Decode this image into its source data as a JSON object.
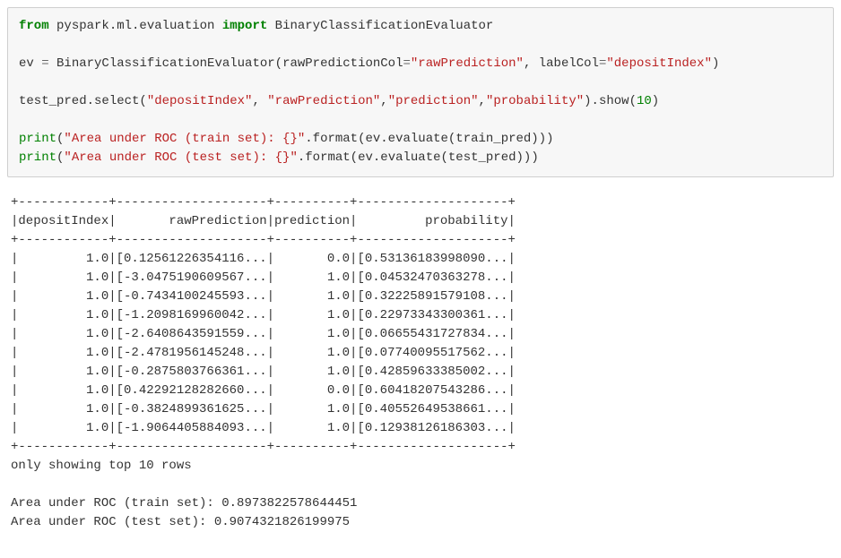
{
  "code": {
    "kw_from": "from",
    "mod1": " pyspark.ml.evaluation ",
    "kw_import": "import",
    "cls1": " BinaryClassificationEvaluator",
    "line2_a": "ev ",
    "op_eq": "=",
    "line2_b": " BinaryClassificationEvaluator(rawPredictionCol",
    "line2_c": "=",
    "str_rawpred": "\"rawPrediction\"",
    "line2_d": ", labelCol",
    "line2_e": "=",
    "str_depidx": "\"depositIndex\"",
    "line2_f": ")",
    "line3_a": "test_pred.select(",
    "str_depidx2": "\"depositIndex\"",
    "line3_b": ", ",
    "str_rawpred2": "\"rawPrediction\"",
    "line3_c": ",",
    "str_pred": "\"prediction\"",
    "line3_d": ",",
    "str_prob": "\"probability\"",
    "line3_e": ").show(",
    "num_10": "10",
    "line3_f": ")",
    "print1": "print",
    "line4_a": "(",
    "str_train": "\"Area under ROC (train set): {}\"",
    "line4_b": ".format(ev.evaluate(train_pred)))",
    "print2": "print",
    "line5_a": "(",
    "str_test": "\"Area under ROC (test set): {}\"",
    "line5_b": ".format(ev.evaluate(test_pred)))"
  },
  "output": {
    "sep": "+------------+--------------------+----------+--------------------+",
    "header": "|depositIndex|       rawPrediction|prediction|         probability|",
    "rows": [
      "|         1.0|[0.12561226354116...|       0.0|[0.53136183998090...|",
      "|         1.0|[-3.0475190609567...|       1.0|[0.04532470363278...|",
      "|         1.0|[-0.7434100245593...|       1.0|[0.32225891579108...|",
      "|         1.0|[-1.2098169960042...|       1.0|[0.22973343300361...|",
      "|         1.0|[-2.6408643591559...|       1.0|[0.06655431727834...|",
      "|         1.0|[-2.4781956145248...|       1.0|[0.07740095517562...|",
      "|         1.0|[-0.2875803766361...|       1.0|[0.42859633385002...|",
      "|         1.0|[0.42292128282660...|       0.0|[0.60418207543286...|",
      "|         1.0|[-0.3824899361625...|       1.0|[0.40552649538661...|",
      "|         1.0|[-1.9064405884093...|       1.0|[0.12938126186303...|"
    ],
    "footer1": "only showing top 10 rows",
    "footer2": "Area under ROC (train set): 0.8973822578644451",
    "footer3": "Area under ROC (test set): 0.9074321826199975"
  }
}
